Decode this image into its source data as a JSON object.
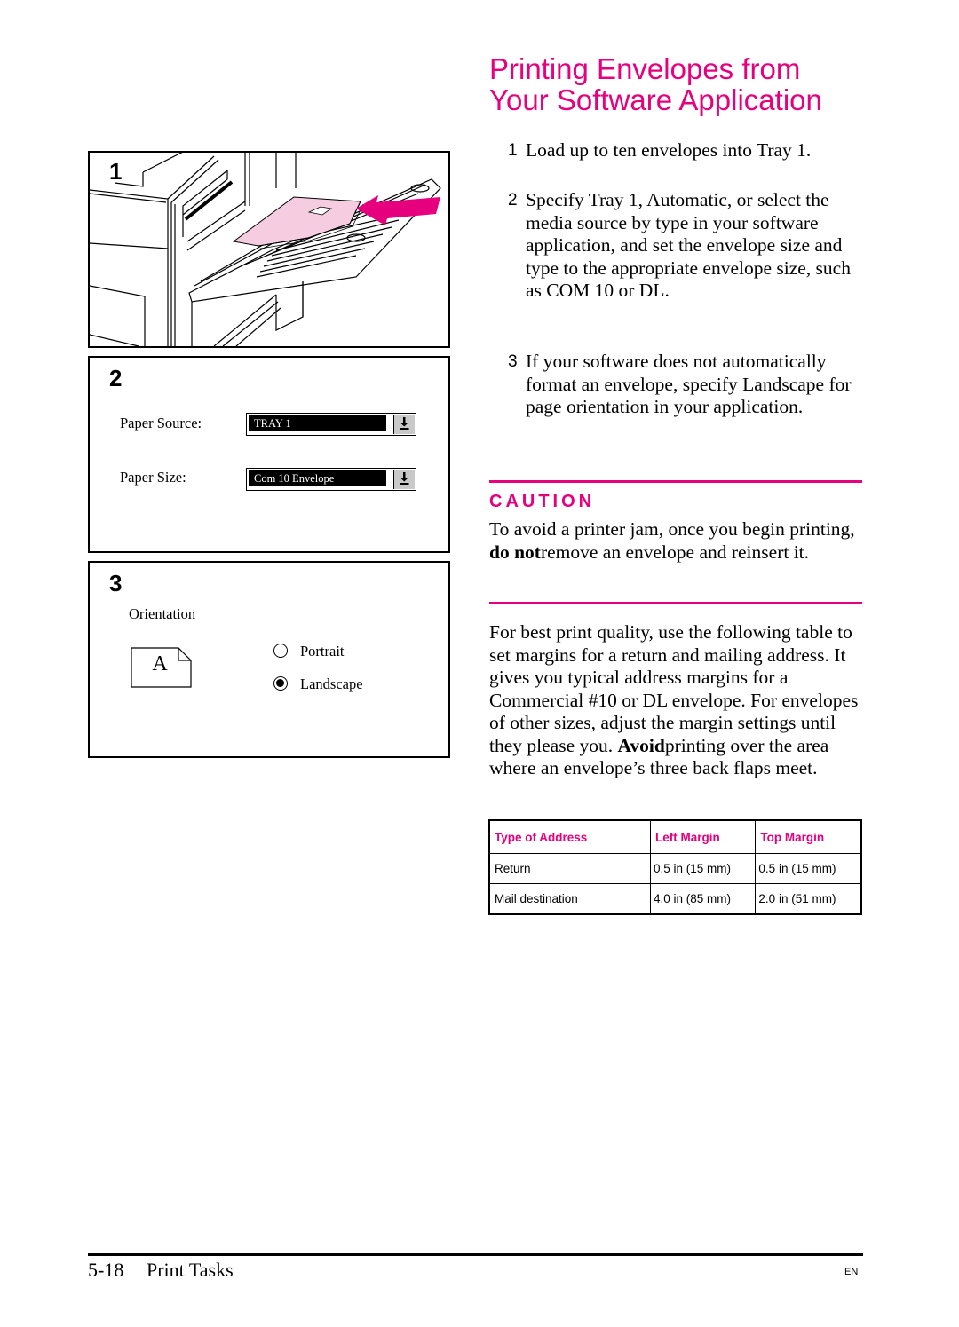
{
  "title": {
    "line1": "Printing Envelopes from",
    "line2": "Your Software Application"
  },
  "steps": [
    {
      "num": "1",
      "text": "Load up to ten envelopes into Tray 1."
    },
    {
      "num": "2",
      "text": "Specify Tray 1, Automatic, or select the media source by type in your software application, and set the envelope size and type to the appropriate envelope size, such as COM 10 or DL."
    },
    {
      "num": "3",
      "text": "If your software does not automatically format an envelope, specify Landscape for page orientation in your application."
    }
  ],
  "caution": {
    "heading": "CAUTION",
    "before": "To avoid a printer jam, once you begin printing, ",
    "bold": "do not",
    "after": "remove an envelope and reinsert it."
  },
  "paragraph": {
    "before": "For best print quality, use the following table to set margins for a return and mailing address. It gives you typical address margins for a Commercial #10 or DL envelope. For envelopes of other sizes, adjust the margin settings until they please you. ",
    "bold": "Avoid",
    "after": "printing over the area where an envelope’s three back flaps meet."
  },
  "table": {
    "headers": [
      "Type of Address",
      "Left Margin",
      "Top Margin"
    ],
    "rows": [
      [
        "Return",
        "0.5 in (15 mm)",
        "0.5 in (15 mm)"
      ],
      [
        "Mail destination",
        "4.0 in (85 mm)",
        "2.0 in (51 mm)"
      ]
    ]
  },
  "figures": {
    "panel1": {
      "num": "1",
      "illustration": "printer-tray1-envelope-loading"
    },
    "panel2": {
      "num": "2",
      "paper_source_label": "Paper Source:",
      "paper_source_value": "TRAY 1",
      "paper_size_label": "Paper Size:",
      "paper_size_value": "Com 10 Envelope",
      "dropdown_icon": "download-arrow-icon"
    },
    "panel3": {
      "num": "3",
      "orientation_label": "Orientation",
      "preview_letter": "A",
      "options": [
        {
          "label": "Portrait",
          "selected": false
        },
        {
          "label": "Landscape",
          "selected": true
        }
      ]
    }
  },
  "footer": {
    "page": "5-18",
    "section": "Print Tasks",
    "lang": "EN"
  },
  "colors": {
    "accent": "#e6007e",
    "envelope": "#f6cde0"
  }
}
